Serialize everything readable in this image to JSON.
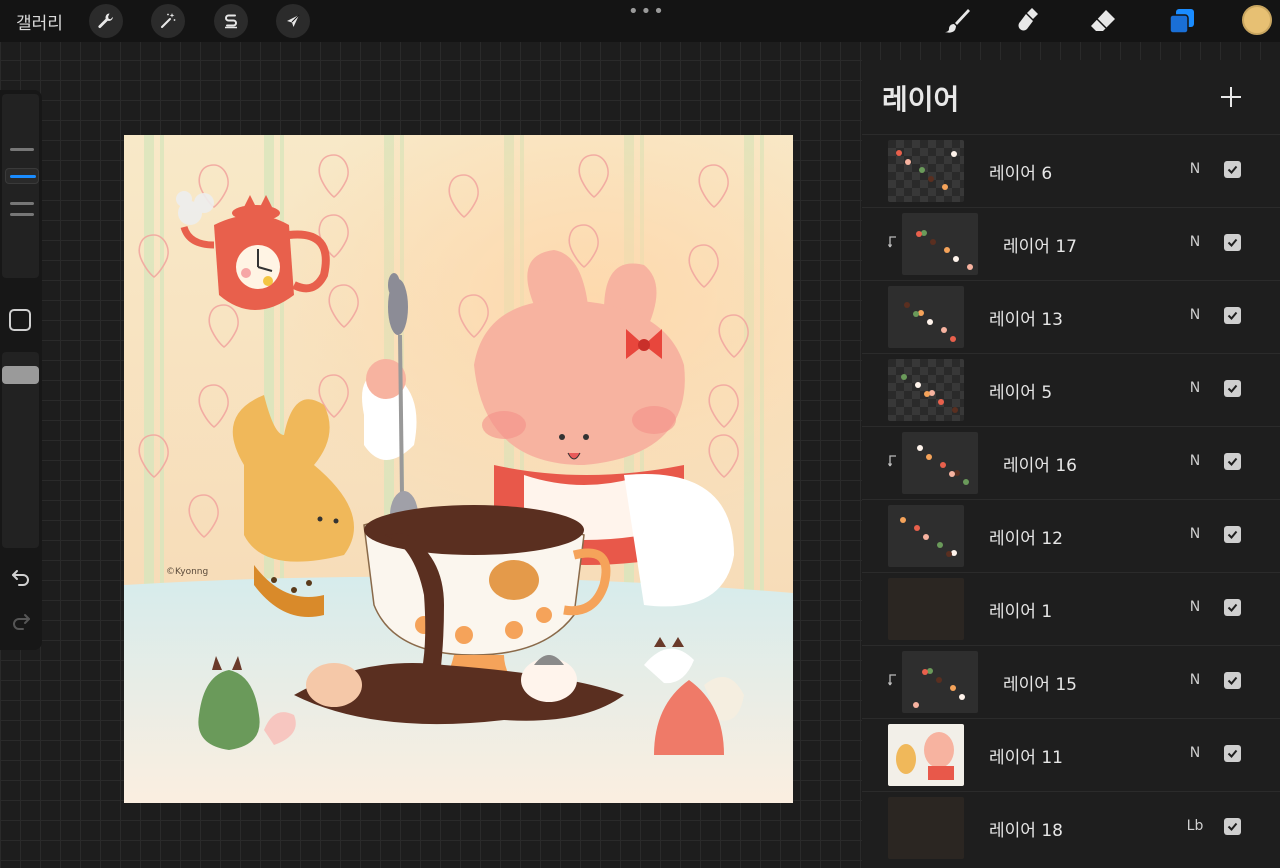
{
  "topbar": {
    "gallery_label": "갤러리",
    "menu_dots": "•••",
    "tools_left": [
      "wrench-icon",
      "magic-wand-icon",
      "selection-s-icon",
      "transform-arrow-icon"
    ],
    "tools_right": [
      "brush-icon",
      "smudge-icon",
      "eraser-icon",
      "layers-icon"
    ],
    "current_color": "#e7c073",
    "active_tool_color": "#1a8cff"
  },
  "canvas": {
    "signature": "©Kyonng"
  },
  "layers_panel": {
    "title": "레이어",
    "add_button": "+",
    "layers": [
      {
        "name": "레이어 6",
        "blend": "N",
        "visible": true,
        "clipped": false
      },
      {
        "name": "레이어 17",
        "blend": "N",
        "visible": true,
        "clipped": true
      },
      {
        "name": "레이어 13",
        "blend": "N",
        "visible": true,
        "clipped": false
      },
      {
        "name": "레이어 5",
        "blend": "N",
        "visible": true,
        "clipped": false
      },
      {
        "name": "레이어 16",
        "blend": "N",
        "visible": true,
        "clipped": true
      },
      {
        "name": "레이어 12",
        "blend": "N",
        "visible": true,
        "clipped": false
      },
      {
        "name": "레이어 1",
        "blend": "N",
        "visible": true,
        "clipped": false
      },
      {
        "name": "레이어 15",
        "blend": "N",
        "visible": true,
        "clipped": true
      },
      {
        "name": "레이어 11",
        "blend": "N",
        "visible": true,
        "clipped": false
      },
      {
        "name": "레이어 18",
        "blend": "Lb",
        "visible": true,
        "clipped": false
      }
    ]
  }
}
